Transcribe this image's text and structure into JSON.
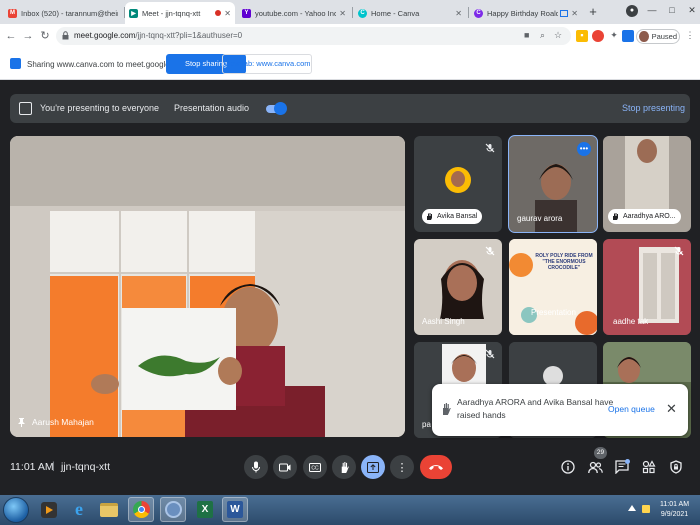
{
  "browser": {
    "tabs": [
      {
        "title": "Inbox (520) - tarannum@thein",
        "favicon": "gmail-icon",
        "color": "#ea4335"
      },
      {
        "title": "Meet - jjn-tqnq-xtt",
        "favicon": "meet-icon",
        "color": "#00897b",
        "active": true
      },
      {
        "title": "youtube.com - Yahoo India Se",
        "favicon": "yahoo-icon",
        "color": "#6001d2"
      },
      {
        "title": "Home - Canva",
        "favicon": "canva-icon",
        "color": "#00c4cc"
      },
      {
        "title": "Happy Birthday Roald Dal",
        "favicon": "canva-icon",
        "color": "#7d2ae8"
      }
    ],
    "url_host": "meet.google.com",
    "url_path": "/jjn-tqnq-xtt?pli=1&authuser=0",
    "profile_status": "Paused"
  },
  "share_bar": {
    "text": "Sharing www.canva.com to meet.google.com",
    "stop_label": "Stop sharing",
    "view_label": "View tab: www.canva.com"
  },
  "presenting": {
    "text": "You're presenting to everyone",
    "audio_label": "Presentation audio",
    "audio_on": true,
    "stop_label": "Stop presenting"
  },
  "main_video": {
    "name": "Aarush Mahajan"
  },
  "tiles": [
    {
      "name": "Avika Bansal",
      "hand_raised": true,
      "muted": true
    },
    {
      "name": "gaurav arora",
      "muted": false,
      "highlight": true
    },
    {
      "name": "Aaradhya ARO...",
      "hand_raised": true,
      "muted": false
    },
    {
      "name": "Aashi Singh",
      "muted": true
    },
    {
      "name": "Presentation",
      "muted": false
    },
    {
      "name": "aadhe tak",
      "muted": true
    },
    {
      "name": "pa",
      "muted": true
    },
    {
      "name": "",
      "muted": false
    },
    {
      "name": "",
      "muted": false
    }
  ],
  "toast": {
    "message": "Aaradhya ARORA and Avika Bansal have raised hands",
    "action": "Open queue"
  },
  "slide": {
    "line1": "ROLY POLY RIDE FROM",
    "line2": "\"THE ENORMOUS",
    "line3": "CROCODILE\""
  },
  "bottom": {
    "time": "11:01 AM",
    "separator": "|",
    "meeting_code": "jjn-tqnq-xtt",
    "participant_count": "29"
  },
  "taskbar": {
    "clock_time": "11:01 AM",
    "clock_date": "9/9/2021"
  }
}
